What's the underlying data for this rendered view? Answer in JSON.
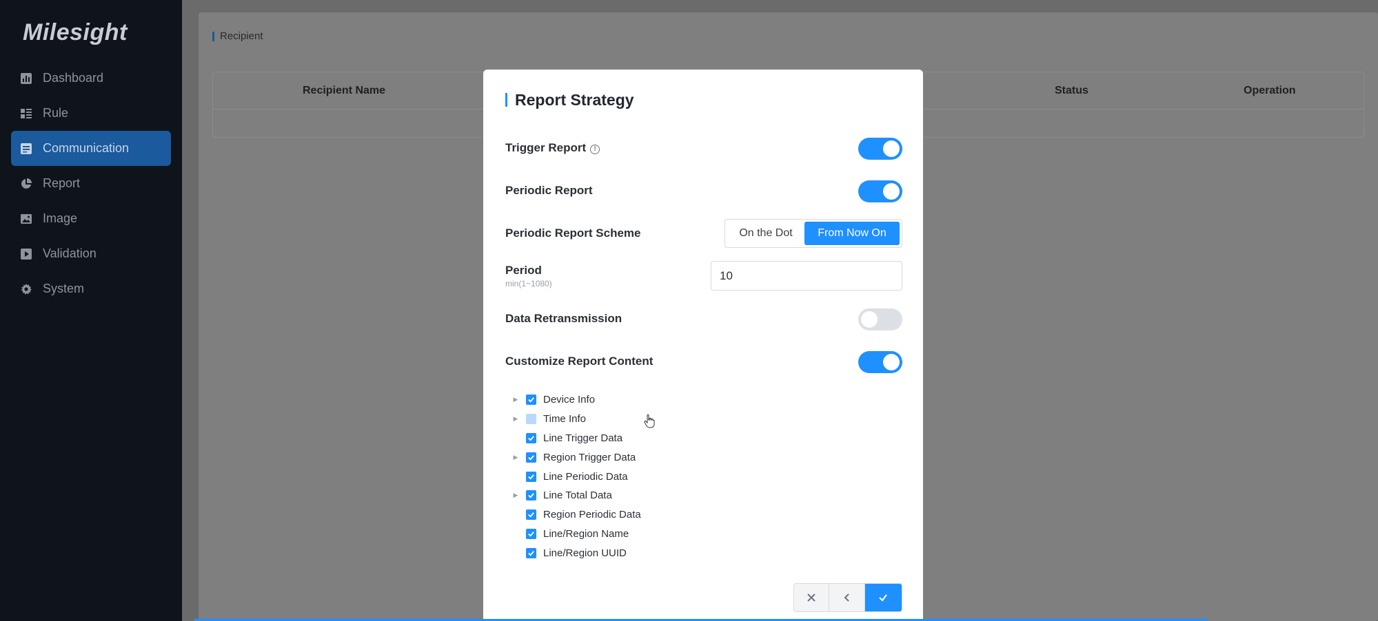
{
  "brand": {
    "logo_text": "Milesight"
  },
  "sidebar": {
    "items": [
      {
        "label": "Dashboard",
        "icon": "chart-icon"
      },
      {
        "label": "Rule",
        "icon": "grid-list-icon"
      },
      {
        "label": "Communication",
        "icon": "message-icon",
        "active": true
      },
      {
        "label": "Report",
        "icon": "pie-icon"
      },
      {
        "label": "Image",
        "icon": "image-icon"
      },
      {
        "label": "Validation",
        "icon": "play-square-icon"
      },
      {
        "label": "System",
        "icon": "gear-icon"
      }
    ]
  },
  "main": {
    "section_title": "Recipient",
    "table": {
      "columns": [
        "Recipient Name",
        "Status",
        "Operation"
      ]
    }
  },
  "modal": {
    "title": "Report Strategy",
    "trigger_report": {
      "label": "Trigger Report",
      "info_icon": "info-icon",
      "enabled": true
    },
    "periodic_report": {
      "label": "Periodic Report",
      "enabled": true
    },
    "scheme": {
      "label": "Periodic Report Scheme",
      "options": [
        "On the Dot",
        "From Now On"
      ],
      "selected": "From Now On"
    },
    "period": {
      "label": "Period",
      "hint": "min(1~1080)",
      "value": "10"
    },
    "data_retransmission": {
      "label": "Data Retransmission",
      "enabled": false
    },
    "customize_content": {
      "label": "Customize Report Content",
      "enabled": true
    },
    "tree": [
      {
        "label": "Device Info",
        "expandable": true,
        "checked": "full"
      },
      {
        "label": "Time Info",
        "expandable": true,
        "checked": "partial"
      },
      {
        "label": "Line Trigger Data",
        "expandable": false,
        "checked": "full"
      },
      {
        "label": "Region Trigger Data",
        "expandable": true,
        "checked": "full"
      },
      {
        "label": "Line Periodic Data",
        "expandable": false,
        "checked": "full"
      },
      {
        "label": "Line Total Data",
        "expandable": true,
        "checked": "full"
      },
      {
        "label": "Region Periodic Data",
        "expandable": false,
        "checked": "full"
      },
      {
        "label": "Line/Region Name",
        "expandable": false,
        "checked": "full"
      },
      {
        "label": "Line/Region UUID",
        "expandable": false,
        "checked": "full"
      }
    ],
    "footer": {
      "cancel_icon": "close-icon",
      "back_icon": "chevron-left-icon",
      "confirm_icon": "check-icon"
    }
  },
  "colors": {
    "accent": "#1e90ff",
    "sidebar_bg": "#0f131a",
    "active_nav": "#1a5a9d"
  }
}
